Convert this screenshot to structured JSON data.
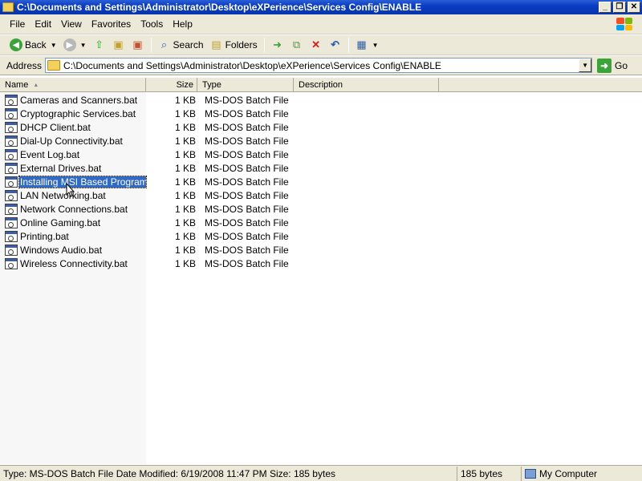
{
  "window": {
    "title": "C:\\Documents and Settings\\Administrator\\Desktop\\eXPerience\\Services Config\\ENABLE",
    "minimize_glyph": "_",
    "maximize_glyph": "❐",
    "close_glyph": "✕"
  },
  "menu": {
    "items": [
      {
        "label": "File"
      },
      {
        "label": "Edit"
      },
      {
        "label": "View"
      },
      {
        "label": "Favorites"
      },
      {
        "label": "Tools"
      },
      {
        "label": "Help"
      }
    ]
  },
  "toolbar": {
    "back_label": "Back",
    "search_label": "Search",
    "folders_label": "Folders",
    "icons": [
      "back-icon",
      "forward-icon",
      "up-folder-icon",
      "search-icon",
      "folders-icon",
      "move-to-icon",
      "copy-to-icon",
      "delete-icon",
      "undo-icon",
      "views-icon"
    ]
  },
  "address": {
    "label": "Address",
    "value": "C:\\Documents and Settings\\Administrator\\Desktop\\eXPerience\\Services Config\\ENABLE",
    "go_label": "Go"
  },
  "columns": {
    "name": "Name",
    "size": "Size",
    "type": "Type",
    "description": "Description"
  },
  "files": [
    {
      "name": "Cameras and Scanners.bat",
      "size": "1 KB",
      "type": "MS-DOS Batch File"
    },
    {
      "name": "Cryptographic Services.bat",
      "size": "1 KB",
      "type": "MS-DOS Batch File"
    },
    {
      "name": "DHCP Client.bat",
      "size": "1 KB",
      "type": "MS-DOS Batch File"
    },
    {
      "name": "Dial-Up Connectivity.bat",
      "size": "1 KB",
      "type": "MS-DOS Batch File"
    },
    {
      "name": "Event Log.bat",
      "size": "1 KB",
      "type": "MS-DOS Batch File"
    },
    {
      "name": "External Drives.bat",
      "size": "1 KB",
      "type": "MS-DOS Batch File"
    },
    {
      "name": "Installing MSI Based Programs...",
      "size": "1 KB",
      "type": "MS-DOS Batch File",
      "selected": true
    },
    {
      "name": "LAN Networking.bat",
      "size": "1 KB",
      "type": "MS-DOS Batch File"
    },
    {
      "name": "Network Connections.bat",
      "size": "1 KB",
      "type": "MS-DOS Batch File"
    },
    {
      "name": "Online Gaming.bat",
      "size": "1 KB",
      "type": "MS-DOS Batch File"
    },
    {
      "name": "Printing.bat",
      "size": "1 KB",
      "type": "MS-DOS Batch File"
    },
    {
      "name": "Windows Audio.bat",
      "size": "1 KB",
      "type": "MS-DOS Batch File"
    },
    {
      "name": "Wireless Connectivity.bat",
      "size": "1 KB",
      "type": "MS-DOS Batch File"
    }
  ],
  "status": {
    "details": "Type: MS-DOS Batch File Date Modified: 6/19/2008 11:47 PM Size: 185 bytes",
    "size": "185 bytes",
    "location": "My Computer"
  },
  "colors": {
    "titlebar": "#0a3cc2",
    "chrome": "#ece9d8",
    "selection": "#316ac5"
  }
}
